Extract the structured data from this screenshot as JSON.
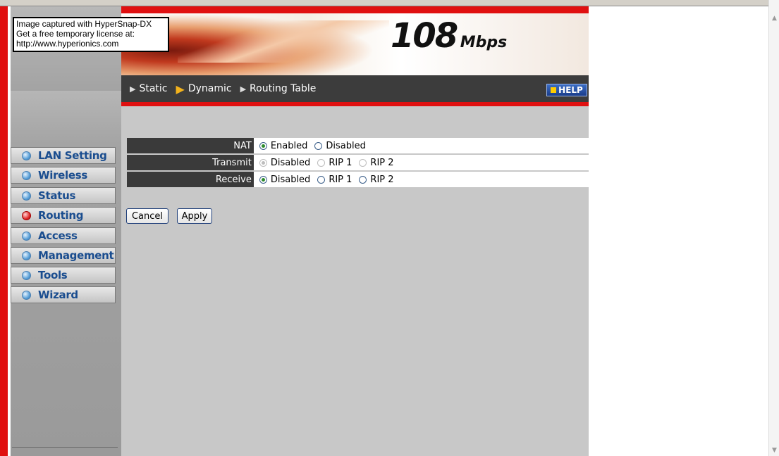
{
  "watermark": {
    "line1": "Image captured with HyperSnap-DX",
    "line2": "Get a free temporary license at:",
    "line3": "http://www.hyperionics.com"
  },
  "banner": {
    "speed_number": "108",
    "speed_unit": "Mbps"
  },
  "tabs": [
    {
      "label": "Static",
      "active": false
    },
    {
      "label": "Dynamic",
      "active": true
    },
    {
      "label": "Routing Table",
      "active": false
    }
  ],
  "help_label": "HELP",
  "sidebar": {
    "items": [
      {
        "label": "LAN Setting",
        "active": false
      },
      {
        "label": "Wireless",
        "active": false
      },
      {
        "label": "Status",
        "active": false
      },
      {
        "label": "Routing",
        "active": true
      },
      {
        "label": "Access",
        "active": false
      },
      {
        "label": "Management",
        "active": false
      },
      {
        "label": "Tools",
        "active": false
      },
      {
        "label": "Wizard",
        "active": false
      }
    ]
  },
  "form": {
    "nat": {
      "label": "NAT",
      "options": [
        {
          "label": "Enabled",
          "checked": true
        },
        {
          "label": "Disabled",
          "checked": false
        }
      ],
      "disabled": false
    },
    "transmit": {
      "label": "Transmit",
      "options": [
        {
          "label": "Disabled",
          "checked": true
        },
        {
          "label": "RIP 1",
          "checked": false
        },
        {
          "label": "RIP 2",
          "checked": false
        }
      ],
      "disabled": true
    },
    "receive": {
      "label": "Receive",
      "options": [
        {
          "label": "Disabled",
          "checked": true
        },
        {
          "label": "RIP 1",
          "checked": false
        },
        {
          "label": "RIP 2",
          "checked": false
        }
      ],
      "disabled": false
    }
  },
  "buttons": {
    "cancel": "Cancel",
    "apply": "Apply"
  },
  "colors": {
    "accent_red": "#e01010",
    "nav_text": "#1a4d8f",
    "tabbar": "#3c3c3c",
    "content_bg": "#c8c8c8"
  }
}
